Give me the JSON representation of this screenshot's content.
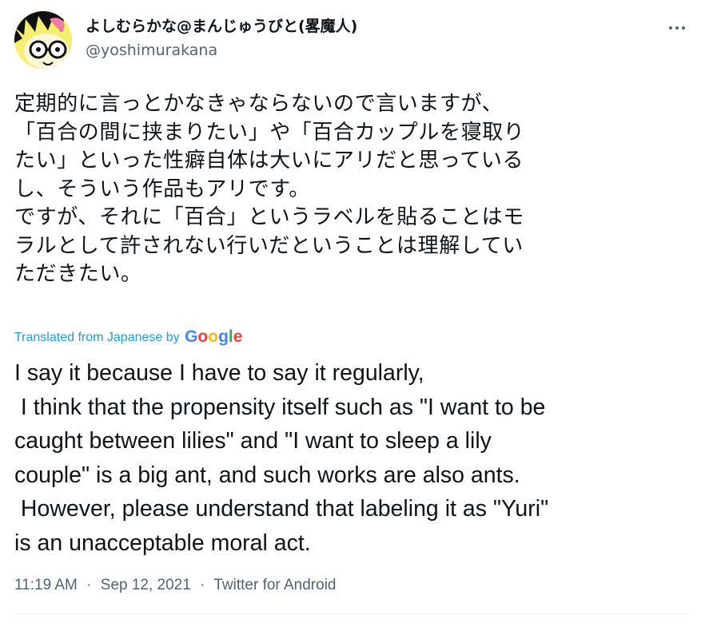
{
  "author": {
    "display_name": "よしむらかな@まんじゅうびと(畧魔人)",
    "handle": "@yoshimurakana",
    "avatar_icon": "cartoon-face-avatar"
  },
  "tweet": {
    "original_lines": [
      "定期的に言っとかなきゃならないので言いますが、",
      "「百合の間に挟まりたい」や「百合カップルを寝取り",
      "たい」といった性癖自体は大いにアリだと思っている",
      "し、そういう作品もアリです。",
      "ですが、それに「百合」というラベルを貼ることはモ",
      "ラルとして許されない行いだということは理解してい",
      "ただきたい。"
    ],
    "translated_label": "Translated from Japanese by",
    "translation_provider": "Google",
    "translation_lines": [
      "I say it because I have to say it regularly,",
      " I think that the propensity itself such as \"I want to be",
      "caught between lilies\" and \"I want to sleep a lily",
      "couple\" is a big ant, and such works are also ants.",
      " However, please understand that labeling it as \"Yuri\"",
      "is an unacceptable moral act."
    ],
    "time": "11:19 AM",
    "date": "Sep 12, 2021",
    "source": "Twitter for Android",
    "separator": "·"
  },
  "colors": {
    "text": "#0f1419",
    "secondary": "#536471",
    "link": "#1d9bf0",
    "divider": "#eff3f4"
  },
  "icons": {
    "more": "more-horizontal-icon"
  }
}
